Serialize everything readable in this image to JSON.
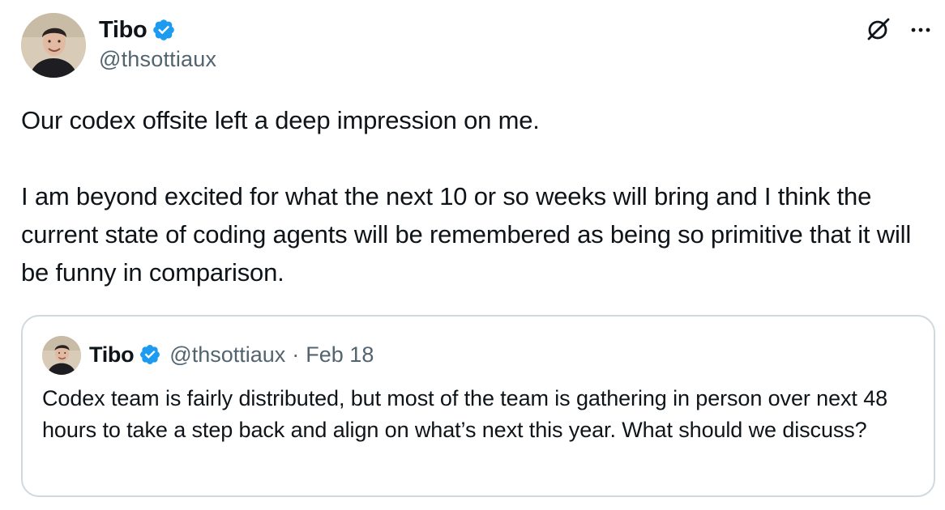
{
  "tweet": {
    "author": {
      "name": "Tibo",
      "handle": "@thsottiaux",
      "verified": true,
      "avatar_icon": "profile-photo"
    },
    "paragraphs": [
      "Our codex offsite left a deep impression on me.",
      "I am beyond excited for what the next 10 or so weeks will bring and I think the current state of coding agents will be remembered as being so primitive that it will be funny in comparison."
    ],
    "actions": {
      "grok_icon": "grok-icon",
      "more_icon": "more-options-icon"
    }
  },
  "quoted_tweet": {
    "author": {
      "name": "Tibo",
      "handle": "@thsottiaux",
      "verified": true
    },
    "separator": "·",
    "date": "Feb 18",
    "text": "Codex team is fairly distributed, but most of the team is gathering in person over next 48 hours to take a step back and align on what’s next this year. What should we discuss?"
  },
  "colors": {
    "verified_blue": "#1d9bf0",
    "text_primary": "#0f1419",
    "text_secondary": "#536471",
    "border": "#cfd9de"
  }
}
